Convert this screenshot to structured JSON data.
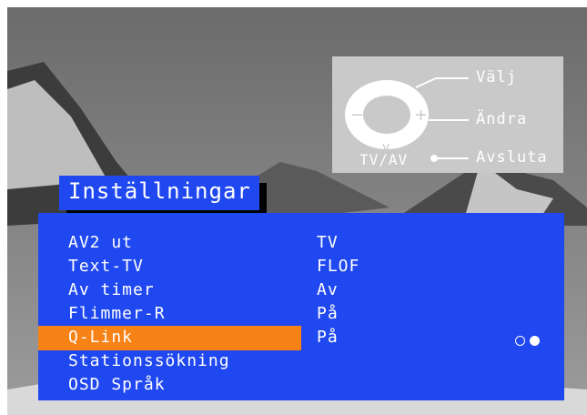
{
  "help": {
    "select_label": "Välj",
    "change_label": "Ändra",
    "exit_label": "Avsluta",
    "tvav_label": "TV/AV"
  },
  "menu": {
    "title": "Inställningar",
    "items": [
      {
        "label": "AV2 ut",
        "value": "TV"
      },
      {
        "label": "Text-TV",
        "value": "FLOF"
      },
      {
        "label": "Av timer",
        "value": "Av"
      },
      {
        "label": "Flimmer-R",
        "value": "På"
      },
      {
        "label": "Q-Link",
        "value": "På",
        "selected": true
      },
      {
        "label": "Stationssökning",
        "value": ""
      },
      {
        "label": "OSD Språk",
        "value": ""
      }
    ]
  },
  "colors": {
    "menu_bg": "#2048f0",
    "highlight": "#f78215",
    "text": "#ffffff"
  }
}
